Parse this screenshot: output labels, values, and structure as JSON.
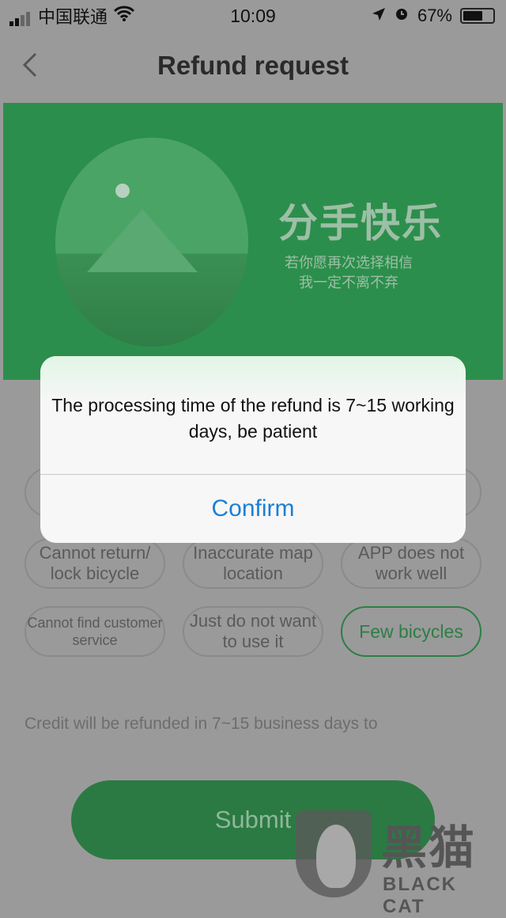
{
  "status_bar": {
    "carrier": "中国联通",
    "time": "10:09",
    "battery": "67%",
    "battery_level": 0.67,
    "icons": [
      "signal-icon",
      "wifi-icon",
      "location-icon",
      "alarm-icon",
      "battery-icon"
    ]
  },
  "nav": {
    "title": "Refund request",
    "back_icon": "chevron-left-icon"
  },
  "banner": {
    "title": "分手快乐",
    "subtitle_line1": "若你愿再次选择相信",
    "subtitle_line2": "我一定不离不弃"
  },
  "reasons": [
    {
      "label": "Cannot return/ lock bicycle",
      "selected": false
    },
    {
      "label": "Inaccurate map location",
      "selected": false
    },
    {
      "label": "APP does not work well",
      "selected": false
    },
    {
      "label": "Cannot find customer service",
      "selected": false
    },
    {
      "label": "Just do not want to use it",
      "selected": false
    },
    {
      "label": "Few bicycles",
      "selected": true
    }
  ],
  "credit_note": "Credit will be refunded in 7~15 business days to",
  "submit_label": "Submit",
  "dialog": {
    "message": "The processing time of the refund is 7~15 working days, be patient",
    "confirm_label": "Confirm"
  },
  "watermark": {
    "cn": "黑猫",
    "en": "BLACK CAT"
  },
  "colors": {
    "accent": "#1b7fd6",
    "brand_green": "#2fa55a"
  }
}
